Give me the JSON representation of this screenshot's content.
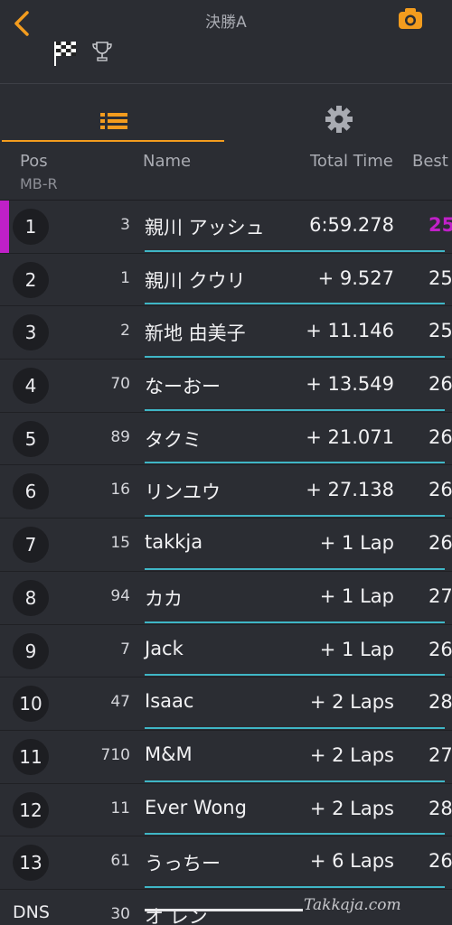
{
  "header": {
    "title": "決勝A",
    "accent": "#f39c1e"
  },
  "columns": {
    "pos": "Pos",
    "name": "Name",
    "total": "Total Time",
    "best": "Best"
  },
  "class_label": "MB-R",
  "rows": [
    {
      "pos": "1",
      "num": "3",
      "name": "親川 アッシュ",
      "total": "6:59.278",
      "best": "25",
      "fastest": true
    },
    {
      "pos": "2",
      "num": "1",
      "name": "親川 クウリ",
      "total": "+ 9.527",
      "best": "25"
    },
    {
      "pos": "3",
      "num": "2",
      "name": "新地 由美子",
      "total": "+ 11.146",
      "best": "25"
    },
    {
      "pos": "4",
      "num": "70",
      "name": "なーおー",
      "total": "+ 13.549",
      "best": "26"
    },
    {
      "pos": "5",
      "num": "89",
      "name": "タクミ",
      "total": "+ 21.071",
      "best": "26"
    },
    {
      "pos": "6",
      "num": "16",
      "name": "リンユウ",
      "total": "+ 27.138",
      "best": "26"
    },
    {
      "pos": "7",
      "num": "15",
      "name": "takkja",
      "total": "+ 1 Lap",
      "best": "26"
    },
    {
      "pos": "8",
      "num": "94",
      "name": "カカ",
      "total": "+ 1 Lap",
      "best": "27"
    },
    {
      "pos": "9",
      "num": "7",
      "name": "Jack",
      "total": "+ 1 Lap",
      "best": "26"
    },
    {
      "pos": "10",
      "num": "47",
      "name": "Isaac",
      "total": "+ 2 Laps",
      "best": "28"
    },
    {
      "pos": "11",
      "num": "710",
      "name": "M&M",
      "total": "+ 2 Laps",
      "best": "27"
    },
    {
      "pos": "12",
      "num": "11",
      "name": "Ever Wong",
      "total": "+ 2 Laps",
      "best": "28"
    },
    {
      "pos": "13",
      "num": "61",
      "name": "うっちー",
      "total": "+ 6 Laps",
      "best": "26"
    },
    {
      "pos": "DNS",
      "num": "30",
      "name": "オ レン",
      "total": "",
      "best": ""
    }
  ],
  "watermark": "Takkaja.com",
  "colors": {
    "fastest": "#c020c8",
    "line": "#3fb6c6",
    "background": "#2b2d33"
  }
}
